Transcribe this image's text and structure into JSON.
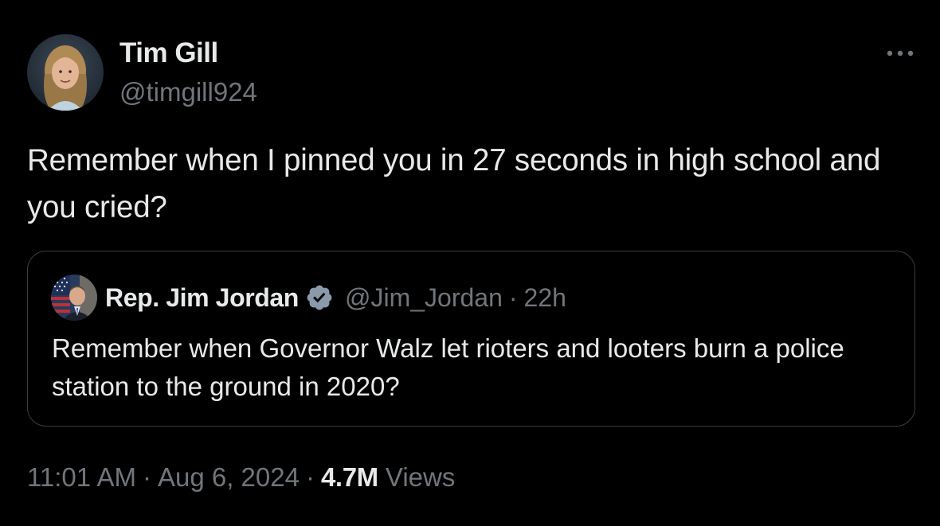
{
  "tweet": {
    "author_name": "Tim Gill",
    "author_handle": "@timgill924",
    "more_icon": "more-horizontal-icon",
    "text": "Remember when I pinned you in 27 seconds in high school and you cried?"
  },
  "quote": {
    "author_name": "Rep. Jim Jordan",
    "verified_icon": "verified-badge-icon",
    "author_handle": "@Jim_Jordan",
    "separator": "·",
    "time": "22h",
    "text": "Remember when Governor Walz let rioters and looters burn a police station to the ground in 2020?"
  },
  "meta": {
    "time": "11:01 AM",
    "separator": "·",
    "date": "Aug 6, 2024",
    "views_count": "4.7M",
    "views_label": "Views"
  },
  "colors": {
    "background": "#000000",
    "text_primary": "#e7e9ea",
    "text_secondary": "#71767b",
    "border": "#3a3e42",
    "verified_blue": "#8a9aab"
  }
}
